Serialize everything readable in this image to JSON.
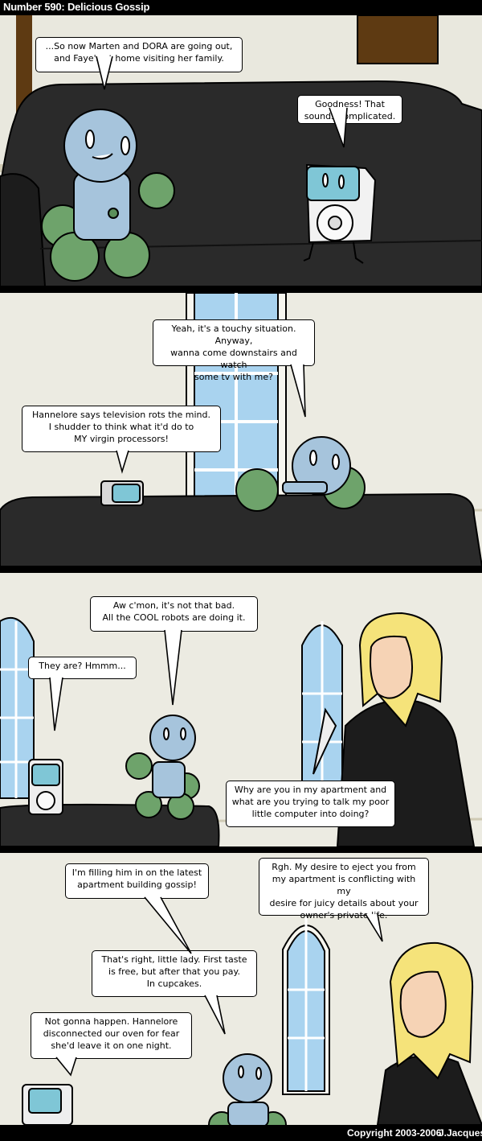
{
  "comic": {
    "title": "Number 590: Delicious Gossip",
    "copyright": "Copyright 2003-2006",
    "author": "J.Jacques"
  },
  "panels": [
    {
      "bubbles": [
        {
          "lines": [
            "...So now Marten and DORA are going out,",
            "and Faye's at home visiting her family."
          ]
        },
        {
          "lines": [
            "Goodness! That",
            "sounds complicated."
          ]
        }
      ]
    },
    {
      "bubbles": [
        {
          "lines": [
            "Yeah, it's a touchy situation. Anyway,",
            "wanna come downstairs and watch",
            "some tv with me?"
          ]
        },
        {
          "lines": [
            "Hannelore says television rots the mind.",
            "I shudder to think what it'd do to",
            "MY virgin processors!"
          ]
        }
      ]
    },
    {
      "bubbles": [
        {
          "lines": [
            "Aw c'mon, it's not that bad.",
            "All the COOL robots are doing it."
          ]
        },
        {
          "lines": [
            "They are? Hmmm..."
          ]
        },
        {
          "lines": [
            "Why are you in my apartment and",
            "what are you trying to talk my poor",
            "little computer into doing?"
          ]
        }
      ]
    },
    {
      "bubbles": [
        {
          "lines": [
            "I'm filling him in on the latest",
            "apartment building gossip!"
          ]
        },
        {
          "lines": [
            "Rgh. My desire to eject you from",
            "my apartment is conflicting with my",
            "desire for juicy details about your",
            "owner's private life."
          ]
        },
        {
          "lines": [
            "That's right, little lady. First taste",
            "is free, but after that you pay.",
            "In cupcakes."
          ]
        },
        {
          "lines": [
            "Not gonna happen. Hannelore",
            "disconnected our oven for fear",
            "she'd leave it on one night."
          ]
        }
      ]
    }
  ]
}
